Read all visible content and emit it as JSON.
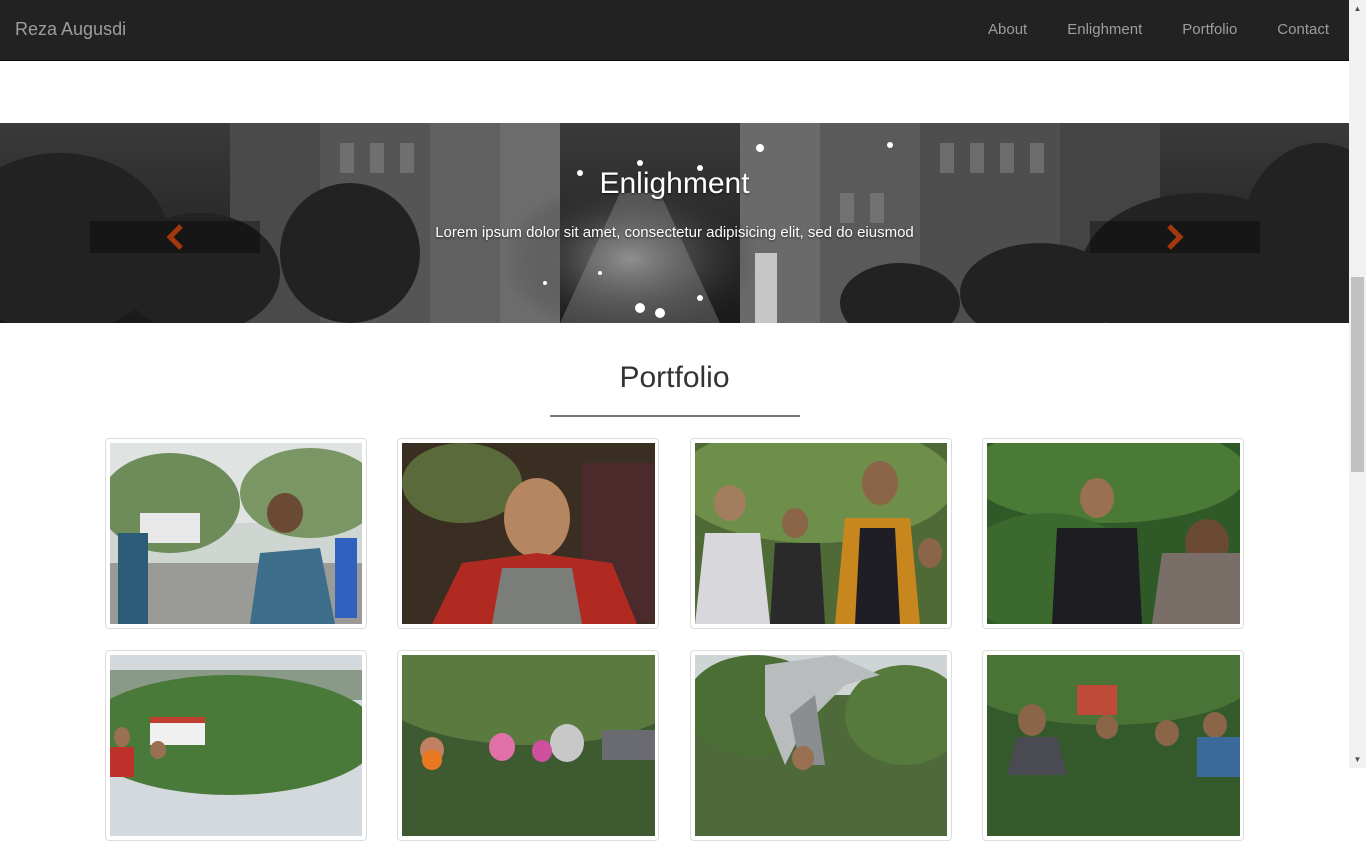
{
  "navbar": {
    "brand": "Reza Augusdi",
    "links": [
      "About",
      "Enlighment",
      "Portfolio",
      "Contact"
    ]
  },
  "carousel": {
    "heading": "Enlighment",
    "text": "Lorem ipsum dolor sit amet, consectetur adipisicing elit, sed do eiusmod",
    "prev_icon": "chevron-left-icon",
    "next_icon": "chevron-right-icon",
    "arrow_color": "#a3380f"
  },
  "portfolio": {
    "title": "Portfolio"
  },
  "colors": {
    "navbar_bg": "#222222",
    "nav_text": "#9d9d9d"
  }
}
